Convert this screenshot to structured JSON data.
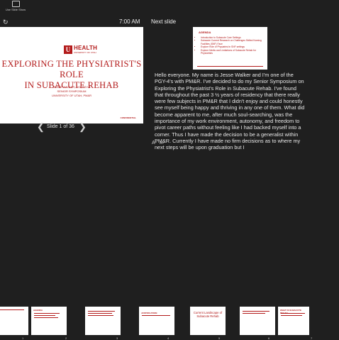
{
  "topbar": {
    "button_label": "Use Slide Show"
  },
  "timer": {
    "clock": "7:00 AM",
    "reset_icon": "refresh-icon"
  },
  "next_slide": {
    "heading": "Next slide",
    "title": "AGENDA",
    "bullets": [
      "Introduction to Subacute Care Settings",
      "Subacute Current Research on Challenges Skilled Nursing Facilities (SNF) Face",
      "Explore Role of Physiatrist in SNF settings",
      "Explore Merits and Limitations of Subacute Rehab for Physiatrists"
    ]
  },
  "current_slide": {
    "logo_letter": "U",
    "logo_text": "HEALTH",
    "logo_sub": "UNIVERSITY OF UTAH",
    "title_line1": "EXPLORING THE PHYSIATRIST'S ROLE",
    "title_line2": "IN SUBACUTE REHAB",
    "author": "JESSE WALKER, DO, PGY-4",
    "event": "SENIOR SYMPOSIUM",
    "institution": "UNIVERSITY OF UTAH, PM&R",
    "confidential": "CONFIDENTIAL"
  },
  "navigation": {
    "counter": "Slide 1 of 36",
    "prev_icon": "chevron-left-icon",
    "next_icon": "chevron-right-icon"
  },
  "notes": {
    "text": "Hello everyone. My name is Jesse Walker and I'm one of the PGY-4's with PM&R. I've decided to do my Senior Symposium on Exploring the Physiatrist's Role in Subacute Rehab. I've found that throughout the past 3 ½ years of residency that there really were few subjects in PM&R that I didn't enjoy and could honestly see myself being happy and thriving in any one of them. What did become apparent to me, after much soul-searching, was the importance of my work environment, autonomy, and freedom to pivot career paths without feeling like I had backed myself into a corner. Thus I have made the decision to be a generalist within PM&R. Currently I have made no firm decisions as to where my next steps will be upon graduation but I"
  },
  "font_controls": {
    "decrease": "A-",
    "increase": "A+"
  },
  "thumbnails": [
    {
      "number": "1",
      "label": ""
    },
    {
      "number": "2",
      "label": "AGENDA"
    },
    {
      "number": "3",
      "label": ""
    },
    {
      "number": "4",
      "label": "JUSTIFICATION"
    },
    {
      "number": "5",
      "label": "Current Landscape of Subacute Rehab"
    },
    {
      "number": "6",
      "label": ""
    },
    {
      "number": "7",
      "label": "WHAT IS SUBACUTE REHAB"
    }
  ],
  "colors": {
    "background": "#1f1f1f",
    "brand": "#b31b1b"
  }
}
